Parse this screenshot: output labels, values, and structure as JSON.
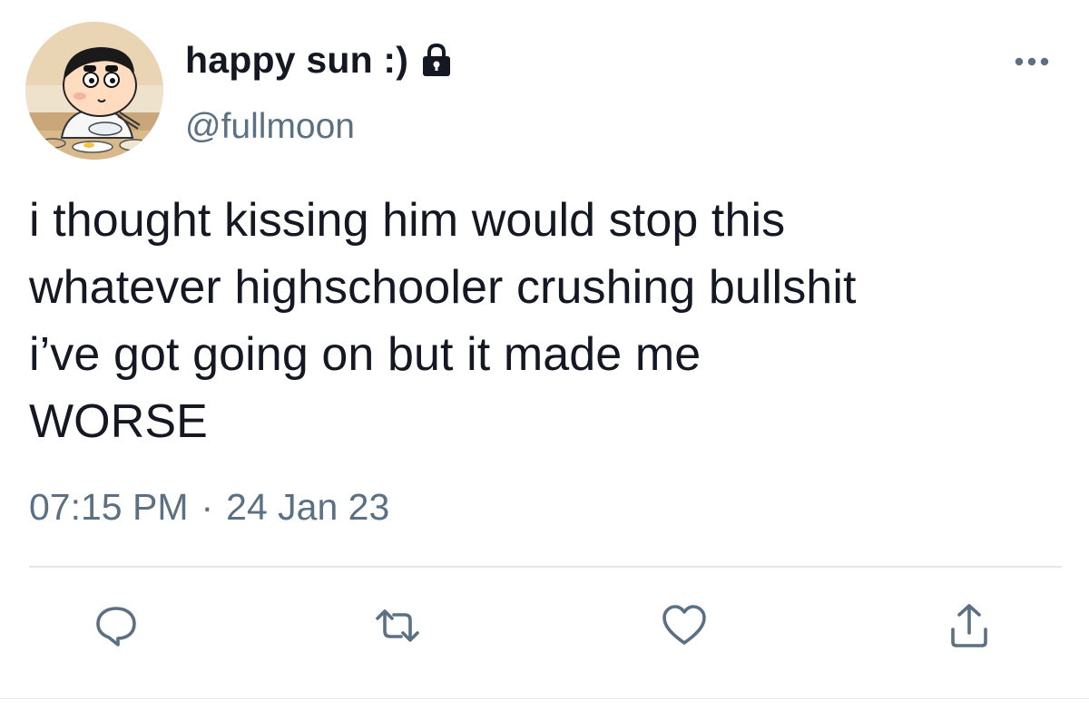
{
  "user": {
    "display_name": "happy sun :)",
    "handle": "@fullmoon",
    "protected_icon": "lock-icon",
    "avatar": "cartoon-avatar"
  },
  "tweet": {
    "lines": [
      "i thought kissing him would stop this",
      "whatever highschooler crushing bullshit",
      "i’ve got going on but it made me",
      "WORSE"
    ],
    "time": "07:15 PM",
    "separator": "·",
    "date": "24 Jan 23"
  },
  "actions": {
    "reply_icon": "reply-icon",
    "retweet_icon": "retweet-icon",
    "like_icon": "heart-icon",
    "share_icon": "share-icon",
    "more_icon": "more-icon"
  },
  "colors": {
    "text": "#141823",
    "secondary": "#5b7083",
    "divider": "#e1e8ed"
  }
}
